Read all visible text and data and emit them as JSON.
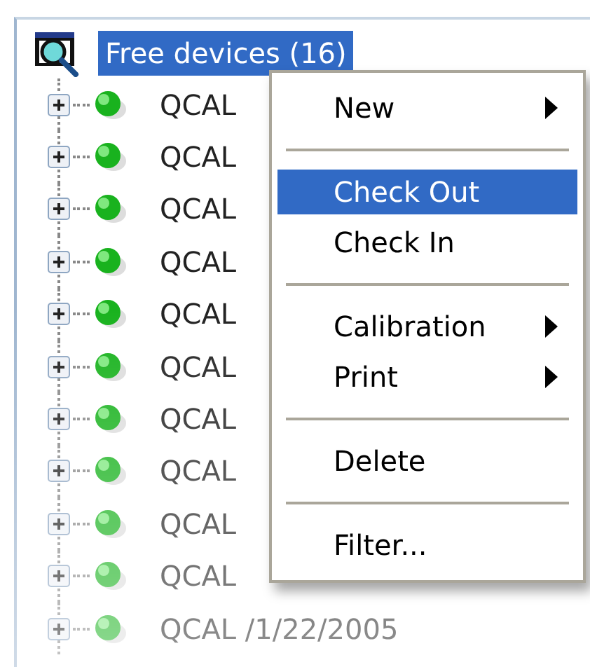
{
  "tree": {
    "root": {
      "label": "Free devices (16)",
      "selected": true,
      "children": [
        {
          "label": "QCAL",
          "expanded": false
        },
        {
          "label": "QCAL",
          "expanded": false
        },
        {
          "label": "QCAL",
          "expanded": false
        },
        {
          "label": "QCAL",
          "expanded": false
        },
        {
          "label": "QCAL",
          "expanded": false
        },
        {
          "label": "QCAL",
          "expanded": false
        },
        {
          "label": "QCAL",
          "expanded": false
        },
        {
          "label": "QCAL",
          "expanded": false
        },
        {
          "label": "QCAL",
          "expanded": false
        },
        {
          "label": "QCAL",
          "expanded": false
        },
        {
          "label": "QCAL /1/22/2005",
          "expanded": false
        }
      ]
    }
  },
  "context_menu": {
    "items": [
      {
        "kind": "item",
        "label": "New",
        "submenu": true,
        "selected": false
      },
      {
        "kind": "separator"
      },
      {
        "kind": "item",
        "label": "Check Out",
        "submenu": false,
        "selected": true
      },
      {
        "kind": "item",
        "label": "Check In",
        "submenu": false,
        "selected": false
      },
      {
        "kind": "separator"
      },
      {
        "kind": "item",
        "label": "Calibration",
        "submenu": true,
        "selected": false
      },
      {
        "kind": "item",
        "label": "Print",
        "submenu": true,
        "selected": false
      },
      {
        "kind": "separator"
      },
      {
        "kind": "item",
        "label": "Delete",
        "submenu": false,
        "selected": false
      },
      {
        "kind": "separator"
      },
      {
        "kind": "item",
        "label": "Filter...",
        "submenu": false,
        "selected": false
      }
    ]
  }
}
